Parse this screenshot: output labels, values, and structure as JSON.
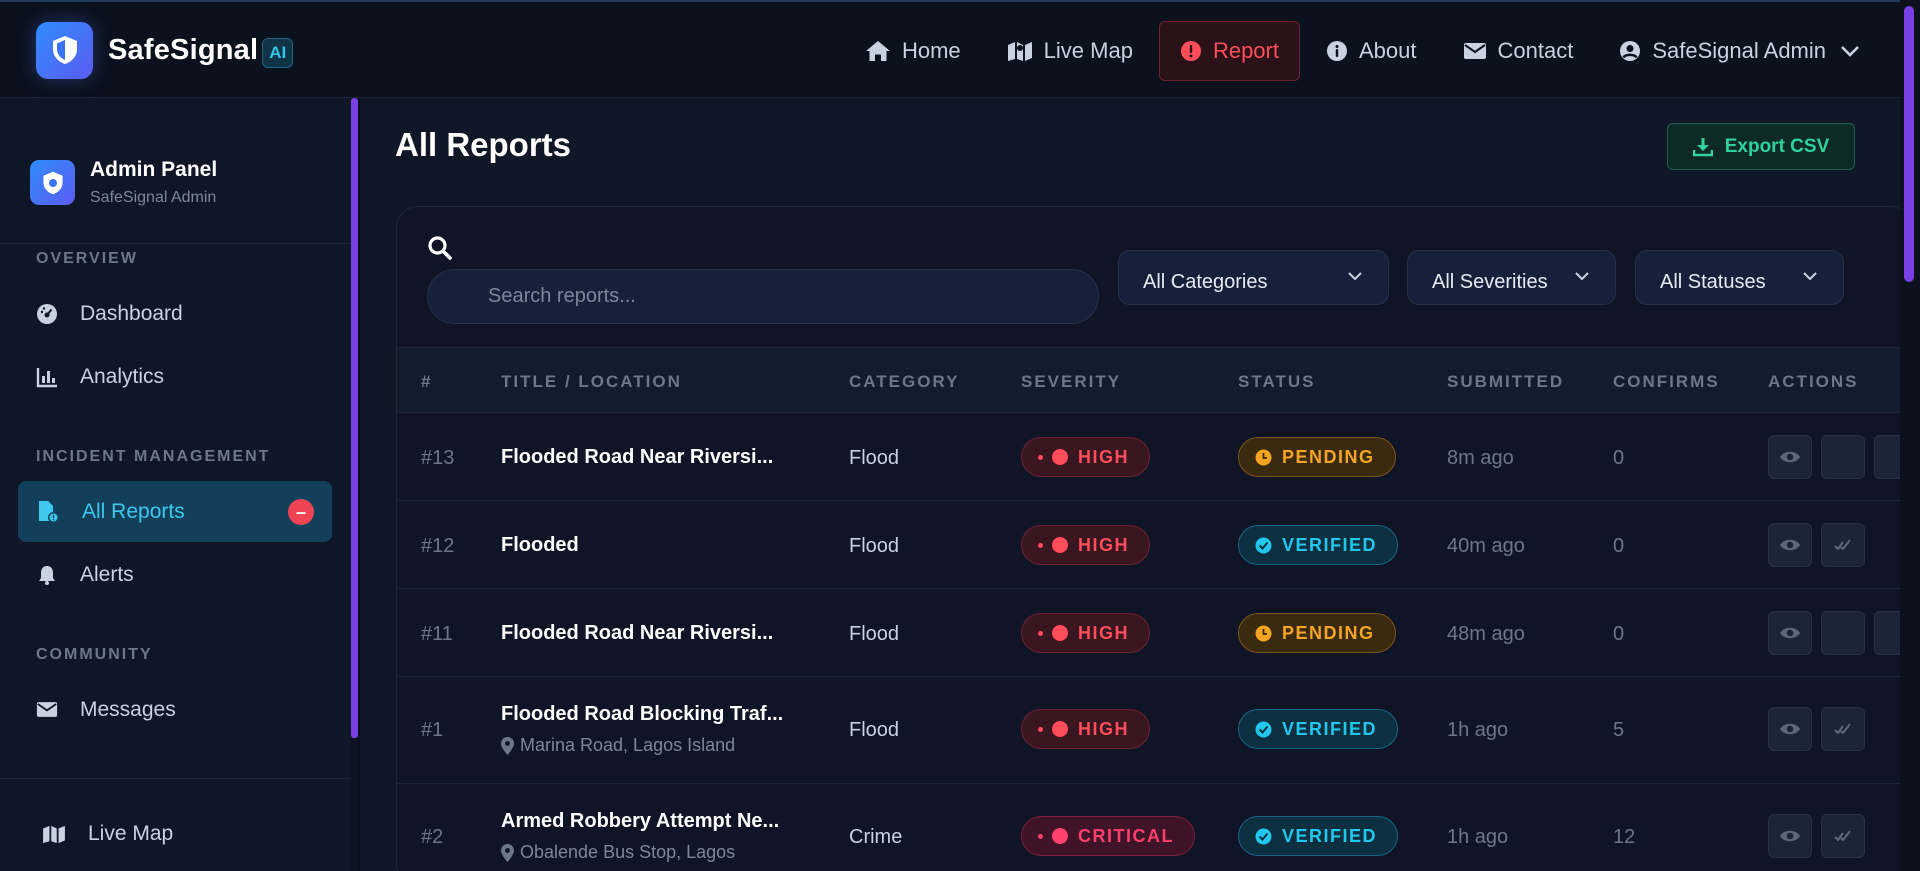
{
  "app": {
    "name": "SafeSignal",
    "badge": "AI"
  },
  "nav": {
    "items": [
      {
        "label": "Home",
        "icon": "home-icon"
      },
      {
        "label": "Live Map",
        "icon": "map-icon"
      },
      {
        "label": "Report",
        "icon": "alert-circle-icon"
      },
      {
        "label": "About",
        "icon": "info-icon"
      },
      {
        "label": "Contact",
        "icon": "envelope-icon"
      },
      {
        "label": "SafeSignal Admin",
        "icon": "user-circle-icon"
      }
    ]
  },
  "sidebar": {
    "title": "Admin Panel",
    "subtitle": "SafeSignal Admin",
    "sections": [
      {
        "label": "OVERVIEW"
      },
      {
        "label": "INCIDENT MANAGEMENT"
      },
      {
        "label": "COMMUNITY"
      }
    ],
    "items": [
      {
        "label": "Dashboard",
        "icon": "gauge-icon"
      },
      {
        "label": "Analytics",
        "icon": "bar-chart-icon"
      },
      {
        "label": "All Reports",
        "icon": "file-report-icon",
        "badge": "–"
      },
      {
        "label": "Alerts",
        "icon": "bell-icon"
      },
      {
        "label": "Messages",
        "icon": "envelope-icon"
      },
      {
        "label": "Live Map",
        "icon": "map-icon"
      }
    ]
  },
  "page": {
    "title": "All Reports",
    "export_label": "Export CSV"
  },
  "filters": {
    "search_placeholder": "Search reports...",
    "category": "All Categories",
    "severity": "All Severities",
    "status": "All Statuses"
  },
  "table": {
    "columns": [
      "#",
      "TITLE / LOCATION",
      "CATEGORY",
      "SEVERITY",
      "STATUS",
      "SUBMITTED",
      "CONFIRMS",
      "ACTIONS"
    ],
    "rows": [
      {
        "id": "#13",
        "title": "Flooded Road Near Riversi...",
        "location": "",
        "category": "Flood",
        "severity": "HIGH",
        "status": "PENDING",
        "submitted": "8m ago",
        "confirms": "0"
      },
      {
        "id": "#12",
        "title": "Flooded",
        "location": "",
        "category": "Flood",
        "severity": "HIGH",
        "status": "VERIFIED",
        "submitted": "40m ago",
        "confirms": "0"
      },
      {
        "id": "#11",
        "title": "Flooded Road Near Riversi...",
        "location": "",
        "category": "Flood",
        "severity": "HIGH",
        "status": "PENDING",
        "submitted": "48m ago",
        "confirms": "0"
      },
      {
        "id": "#1",
        "title": "Flooded Road Blocking Traf...",
        "location": "Marina Road, Lagos Island",
        "category": "Flood",
        "severity": "HIGH",
        "status": "VERIFIED",
        "submitted": "1h ago",
        "confirms": "5"
      },
      {
        "id": "#2",
        "title": "Armed Robbery Attempt Ne...",
        "location": "Obalende Bus Stop, Lagos",
        "category": "Crime",
        "severity": "CRITICAL",
        "status": "VERIFIED",
        "submitted": "1h ago",
        "confirms": "12"
      }
    ]
  },
  "colors": {
    "accent_purple": "#7b3fe4",
    "danger": "#ff4d5a",
    "pending": "#f5a524",
    "verified": "#22c7ee",
    "export": "#2fd39b"
  }
}
